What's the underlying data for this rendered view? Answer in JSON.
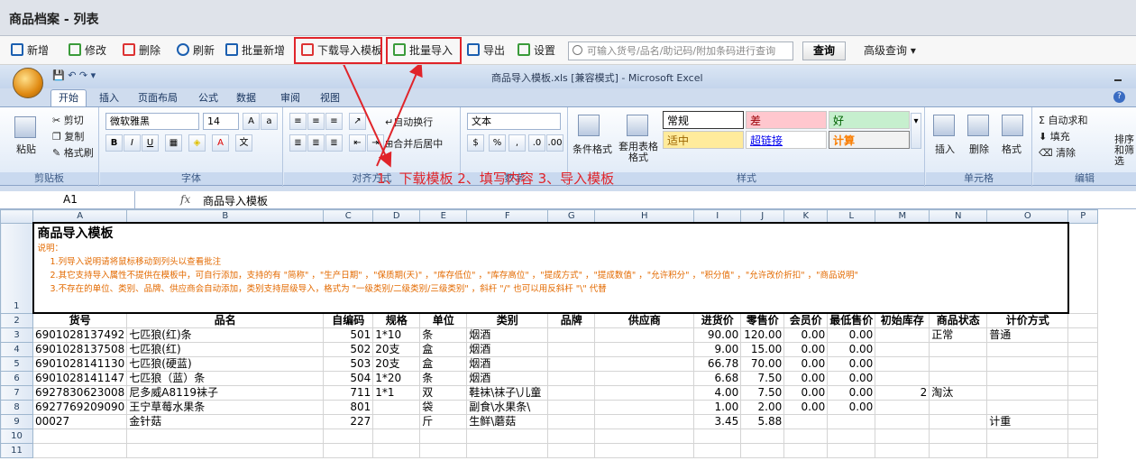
{
  "window_title": "商品档案 - 列表",
  "toolbar": {
    "new": "新增",
    "edit": "修改",
    "delete": "删除",
    "refresh": "刷新",
    "batch_add": "批量新增",
    "download_template": "下载导入模板",
    "batch_import": "批量导入",
    "export": "导出",
    "settings": "设置",
    "search_placeholder": "可输入货号/品名/助记码/附加条码进行查询",
    "query": "查询",
    "advanced_query": "高级查询"
  },
  "excel": {
    "caption": "商品导入模板.xls [兼容模式] - Microsoft Excel",
    "tabs": [
      "开始",
      "插入",
      "页面布局",
      "公式",
      "数据",
      "审阅",
      "视图"
    ],
    "clipboard": {
      "cut": "剪切",
      "copy": "复制",
      "paste": "粘贴",
      "format_painter": "格式刷",
      "label": "剪贴板"
    },
    "font": {
      "name": "微软雅黑",
      "size": "14",
      "label": "字体"
    },
    "alignment": {
      "wrap": "自动换行",
      "merge": "合并后居中",
      "label": "对齐方式"
    },
    "number": {
      "format": "文本",
      "label": "数字"
    },
    "styles": {
      "conditional": "条件格式",
      "table": "套用表格格式",
      "normal": "常规",
      "bad": "差",
      "good": "好",
      "neutral": "适中",
      "hyperlink": "超链接",
      "calc": "计算",
      "label": "样式"
    },
    "cells": {
      "insert": "插入",
      "delete": "删除",
      "format": "格式",
      "label": "单元格"
    },
    "editing": {
      "autosum": "自动求和",
      "fill": "填充",
      "clear": "清除",
      "sort": "排序和筛选",
      "label": "编辑"
    },
    "annotation": "1、下载模板 2、填写内容 3、导入模板",
    "name_box": "A1",
    "formula": "商品导入模板",
    "columns": [
      "A",
      "B",
      "C",
      "D",
      "E",
      "F",
      "G",
      "H",
      "I",
      "J",
      "K",
      "L",
      "M",
      "N",
      "O",
      "P"
    ],
    "notes": {
      "title": "商品导入模板",
      "label": "说明：",
      "line1": "1.列导入说明请将鼠标移动到列头以查看批注",
      "line2": "2.其它支持导入属性不提供在模板中，可自行添加，支持的有 \"简称\" ，\"生产日期\" ，\"保质期(天)\" ，\"库存低位\" ，\"库存高位\" ，\"提成方式\" ，\"提成数值\" ，\"允许积分\" ，\"积分值\" ，\"允许改价折扣\" ，\"商品说明\"",
      "line3": "3.不存在的单位、类别、品牌、供应商会自动添加，类别支持层级导入，格式为 \"一级类别/二级类别/三级类别\" ，斜杆 \"/\" 也可以用反斜杆 \"\\\" 代替"
    },
    "headers": [
      "货号",
      "品名",
      "自编码",
      "规格",
      "单位",
      "类别",
      "品牌",
      "供应商",
      "进货价",
      "零售价",
      "会员价",
      "最低售价",
      "初始库存",
      "商品状态",
      "计价方式"
    ],
    "rows": [
      [
        "6901028137492",
        "七匹狼(红)条",
        "501",
        "1*10",
        "条",
        "烟酒",
        "",
        "",
        "90.00",
        "120.00",
        "0.00",
        "0.00",
        "",
        "正常",
        "普通"
      ],
      [
        "6901028137508",
        "七匹狼(红)",
        "502",
        "20支",
        "盒",
        "烟酒",
        "",
        "",
        "9.00",
        "15.00",
        "0.00",
        "0.00",
        "",
        "",
        ""
      ],
      [
        "6901028141130",
        "七匹狼(硬蓝)",
        "503",
        "20支",
        "盒",
        "烟酒",
        "",
        "",
        "66.78",
        "70.00",
        "0.00",
        "0.00",
        "",
        "",
        ""
      ],
      [
        "6901028141147",
        "七匹狼（蓝）条",
        "504",
        "1*20",
        "条",
        "烟酒",
        "",
        "",
        "6.68",
        "7.50",
        "0.00",
        "0.00",
        "",
        "",
        ""
      ],
      [
        "6927830623008",
        "尼多威A8119袜子",
        "711",
        "1*1",
        "双",
        "鞋袜\\袜子\\儿童",
        "",
        "",
        "4.00",
        "7.50",
        "0.00",
        "0.00",
        "2",
        "淘汰",
        ""
      ],
      [
        "6927769209090",
        "王宁草莓水果条",
        "801",
        "",
        "袋",
        "副食\\水果条\\",
        "",
        "",
        "1.00",
        "2.00",
        "0.00",
        "0.00",
        "",
        "",
        ""
      ],
      [
        "00027",
        "金针菇",
        "227",
        "",
        "斤",
        "生鲜\\蘑菇",
        "",
        "",
        "3.45",
        "5.88",
        "",
        "",
        "",
        "",
        "计重"
      ]
    ],
    "row_numbers": [
      "1",
      "2",
      "3",
      "4",
      "5",
      "6",
      "7",
      "8",
      "9",
      "10",
      "11"
    ]
  }
}
